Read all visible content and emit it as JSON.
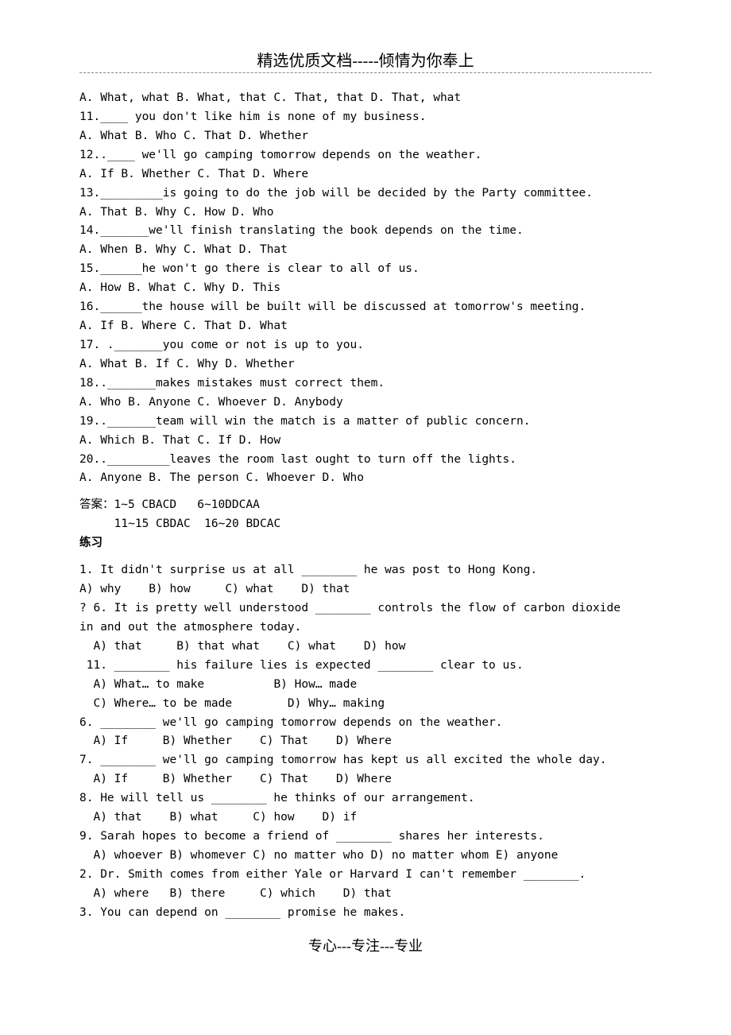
{
  "header": {
    "title": "精选优质文档-----倾情为你奉上"
  },
  "footer": {
    "title": "专心---专注---专业"
  },
  "lines": [
    {
      "text": "A. What, what B. What, that C. That, that D. That, what"
    },
    {
      "text": "11.____ you don't like him is none of my business."
    },
    {
      "text": "A. What B. Who C. That D. Whether"
    },
    {
      "text": "12..____ we'll go camping tomorrow depends on the weather."
    },
    {
      "text": "A. If B. Whether C. That D. Where"
    },
    {
      "text": "13._________is going to do the job will be decided by the Party committee."
    },
    {
      "text": "A. That B. Why C. How D. Who"
    },
    {
      "text": "14._______we'll finish translating the book depends on the time."
    },
    {
      "text": "A. When B. Why C. What D. That"
    },
    {
      "text": "15.______he won't go there is clear to all of us."
    },
    {
      "text": "A. How B. What C. Why D. This"
    },
    {
      "text": "16.______the house will be built will be discussed at tomorrow's meeting."
    },
    {
      "text": "A. If B. Where C. That D. What"
    },
    {
      "text": "17. ._______you come or not is up to you."
    },
    {
      "text": "A. What B. If C. Why D. Whether"
    },
    {
      "text": "18.._______makes mistakes must correct them."
    },
    {
      "text": "A. Who B. Anyone C. Whoever D. Anybody"
    },
    {
      "text": "19.._______team will win the match is a matter of public concern."
    },
    {
      "text": "A. Which B. That C. If D. How"
    },
    {
      "text": "20.._________leaves the room last ought to turn off the lights."
    },
    {
      "text": "A. Anyone B. The person C. Whoever D. Who"
    },
    {
      "text": "",
      "gap": true
    },
    {
      "text": "答案：1~5 CBACD   6~10DDCAA"
    },
    {
      "text": "     11~15 CBDAC  16~20 BDCAC"
    },
    {
      "text": "练习",
      "bold": true
    },
    {
      "text": "",
      "gap": true
    },
    {
      "text": "1. It didn't surprise us at all ________ he was post to Hong Kong."
    },
    {
      "text": "A) why    B) how     C) what    D) that"
    },
    {
      "text": "? 6. It is pretty well understood ________ controls the flow of carbon dioxide"
    },
    {
      "text": "in and out the atmosphere today."
    },
    {
      "text": "  A) that     B) that what    C) what    D) how"
    },
    {
      "text": " 11. ________ his failure lies is expected ________ clear to us."
    },
    {
      "text": "  A) What… to make          B) How… made"
    },
    {
      "text": "  C) Where… to be made        D) Why… making"
    },
    {
      "text": "6. ________ we'll go camping tomorrow depends on the weather."
    },
    {
      "text": "  A) If     B) Whether    C) That    D) Where"
    },
    {
      "text": "7. ________ we'll go camping tomorrow has kept us all excited the whole day."
    },
    {
      "text": "  A) If     B) Whether    C) That    D) Where"
    },
    {
      "text": "8. He will tell us ________ he thinks of our arrangement."
    },
    {
      "text": "  A) that    B) what     C) how    D) if"
    },
    {
      "text": "9. Sarah hopes to become a friend of ________ shares her interests."
    },
    {
      "text": "  A) whoever B) whomever C) no matter who D) no matter whom E) anyone"
    },
    {
      "text": "2. Dr. Smith comes from either Yale or Harvard I can't remember ________."
    },
    {
      "text": "  A) where   B) there     C) which    D) that"
    },
    {
      "text": "3. You can depend on ________ promise he makes."
    }
  ]
}
